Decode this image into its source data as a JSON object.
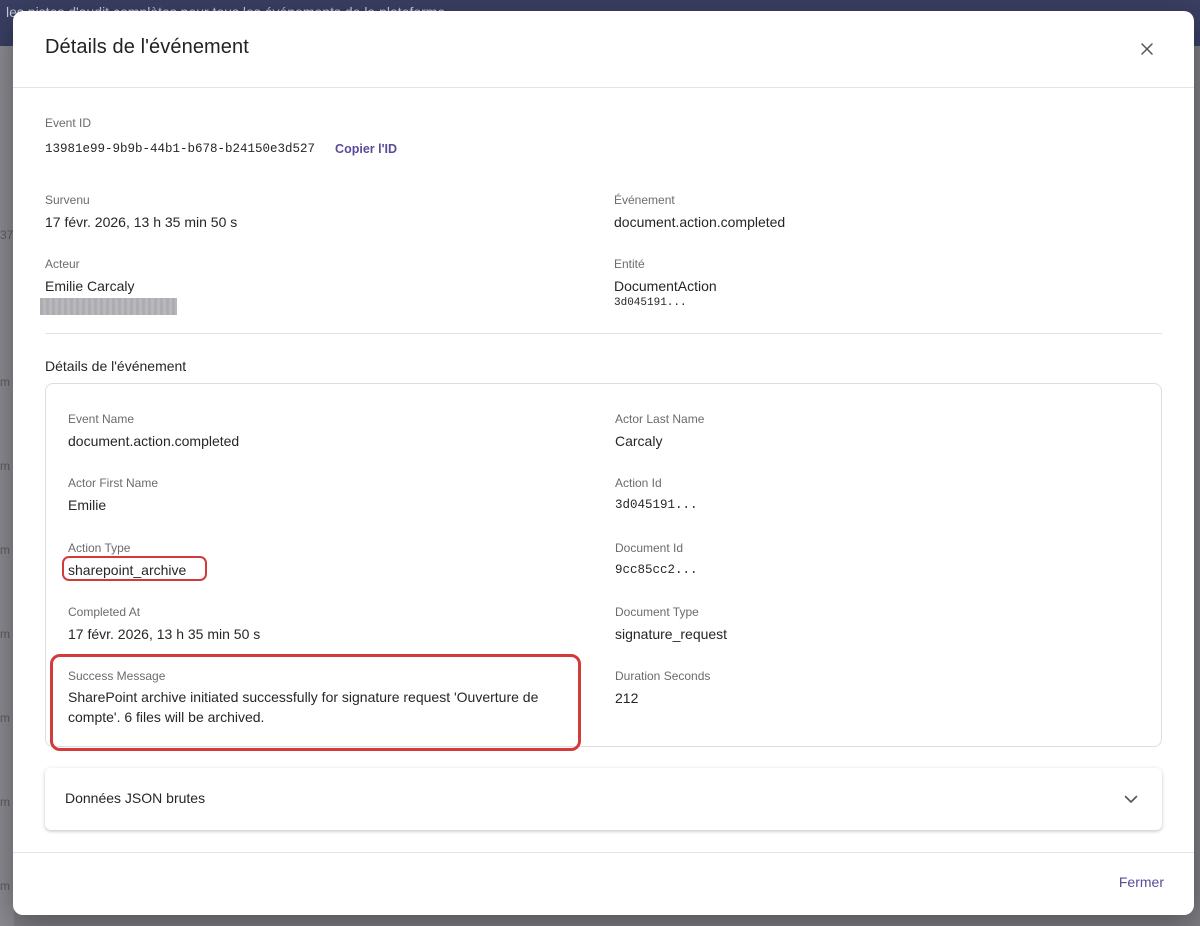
{
  "background": {
    "top_banner_text": "les pistes d'audit complètes pour tous les événements de la plateforme",
    "left_fragment_1": "37",
    "left_fragment_m": "m"
  },
  "modal": {
    "title": "Détails de l'événement",
    "close_icon": "close-icon"
  },
  "event_id": {
    "label": "Event ID",
    "value": "13981e99-9b9b-44b1-b678-b24150e3d527",
    "copy_label": "Copier l'ID"
  },
  "summary": {
    "occurred_label": "Survenu",
    "occurred_value": "17 févr. 2026, 13 h 35 min 50 s",
    "event_label": "Événement",
    "event_value": "document.action.completed",
    "actor_label": "Acteur",
    "actor_value": "Emilie Carcaly",
    "entity_label": "Entité",
    "entity_value": "DocumentAction",
    "entity_id": "3d045191..."
  },
  "details": {
    "section_title": "Détails de l'événement",
    "fields": [
      {
        "label": "Event Name",
        "value": "document.action.completed"
      },
      {
        "label": "Actor Last Name",
        "value": "Carcaly"
      },
      {
        "label": "Actor First Name",
        "value": "Emilie"
      },
      {
        "label": "Action Id",
        "value": "3d045191..."
      },
      {
        "label": "Action Type",
        "value": "sharepoint_archive"
      },
      {
        "label": "Document Id",
        "value": "9cc85cc2..."
      },
      {
        "label": "Completed At",
        "value": "17 févr. 2026, 13 h 35 min 50 s"
      },
      {
        "label": "Document Type",
        "value": "signature_request"
      },
      {
        "label": "Success Message",
        "value": "SharePoint archive initiated successfully for signature request 'Ouverture de compte'. 6 files will be archived."
      },
      {
        "label": "Duration Seconds",
        "value": "212"
      }
    ]
  },
  "json_panel": {
    "title": "Données JSON brutes",
    "chevron_icon": "chevron-down-icon"
  },
  "footer": {
    "close_label": "Fermer"
  },
  "colors": {
    "accent": "#5b4a9a",
    "highlight": "#d33a3a",
    "overlay": "#7d7d83"
  }
}
